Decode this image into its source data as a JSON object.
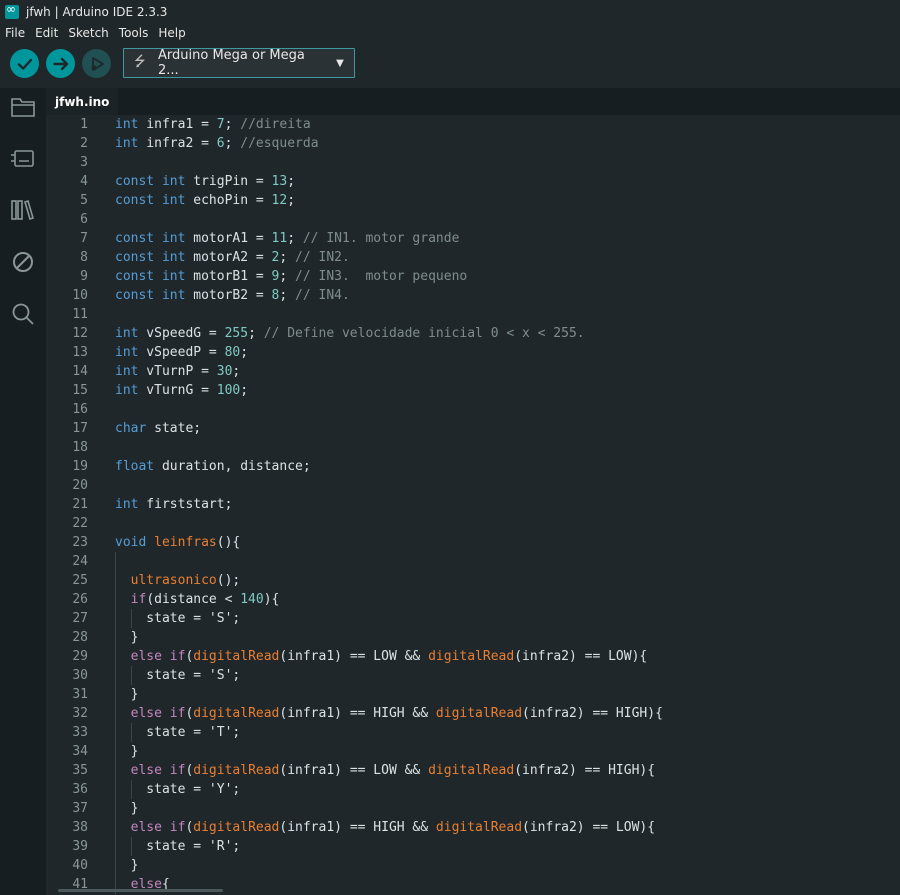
{
  "window": {
    "title": "jfwh | Arduino IDE 2.3.3"
  },
  "menu": [
    "File",
    "Edit",
    "Sketch",
    "Tools",
    "Help"
  ],
  "toolbar": {
    "verify_icon": "check-icon",
    "upload_icon": "arrow-right-icon",
    "debug_icon": "debug-icon",
    "board_label": "Arduino Mega or Mega 2...",
    "usb_icon": "usb-icon",
    "dropdown_icon": "chevron-down-icon",
    "accent": "#00979c"
  },
  "sidebar": [
    "folder-icon",
    "board-icon",
    "library-icon",
    "debug-disabled-icon",
    "search-icon"
  ],
  "tabs": [
    {
      "label": "jfwh.ino"
    }
  ],
  "editor": {
    "lines": [
      [
        [
          "ty",
          "int"
        ],
        [
          "",
          " infra1 = "
        ],
        [
          "num",
          "7"
        ],
        [
          "",
          "; "
        ],
        [
          "cm",
          "//direita"
        ]
      ],
      [
        [
          "ty",
          "int"
        ],
        [
          "",
          " infra2 = "
        ],
        [
          "num",
          "6"
        ],
        [
          "",
          "; "
        ],
        [
          "cm",
          "//esquerda"
        ]
      ],
      [],
      [
        [
          "ty",
          "const"
        ],
        [
          "",
          " "
        ],
        [
          "ty",
          "int"
        ],
        [
          "",
          " trigPin = "
        ],
        [
          "num",
          "13"
        ],
        [
          "",
          ";"
        ]
      ],
      [
        [
          "ty",
          "const"
        ],
        [
          "",
          " "
        ],
        [
          "ty",
          "int"
        ],
        [
          "",
          " echoPin = "
        ],
        [
          "num",
          "12"
        ],
        [
          "",
          ";"
        ]
      ],
      [],
      [
        [
          "ty",
          "const"
        ],
        [
          "",
          " "
        ],
        [
          "ty",
          "int"
        ],
        [
          "",
          " motorA1 = "
        ],
        [
          "num",
          "11"
        ],
        [
          "",
          "; "
        ],
        [
          "cm",
          "// IN1. motor grande"
        ]
      ],
      [
        [
          "ty",
          "const"
        ],
        [
          "",
          " "
        ],
        [
          "ty",
          "int"
        ],
        [
          "",
          " motorA2 = "
        ],
        [
          "num",
          "2"
        ],
        [
          "",
          "; "
        ],
        [
          "cm",
          "// IN2."
        ]
      ],
      [
        [
          "ty",
          "const"
        ],
        [
          "",
          " "
        ],
        [
          "ty",
          "int"
        ],
        [
          "",
          " motorB1 = "
        ],
        [
          "num",
          "9"
        ],
        [
          "",
          "; "
        ],
        [
          "cm",
          "// IN3.  motor pequeno"
        ]
      ],
      [
        [
          "ty",
          "const"
        ],
        [
          "",
          " "
        ],
        [
          "ty",
          "int"
        ],
        [
          "",
          " motorB2 = "
        ],
        [
          "num",
          "8"
        ],
        [
          "",
          "; "
        ],
        [
          "cm",
          "// IN4."
        ]
      ],
      [],
      [
        [
          "ty",
          "int"
        ],
        [
          "",
          " vSpeedG = "
        ],
        [
          "num",
          "255"
        ],
        [
          "",
          "; "
        ],
        [
          "cm",
          "// Define velocidade inicial 0 < x < 255."
        ]
      ],
      [
        [
          "ty",
          "int"
        ],
        [
          "",
          " vSpeedP = "
        ],
        [
          "num",
          "80"
        ],
        [
          "",
          ";"
        ]
      ],
      [
        [
          "ty",
          "int"
        ],
        [
          "",
          " vTurnP = "
        ],
        [
          "num",
          "30"
        ],
        [
          "",
          ";"
        ]
      ],
      [
        [
          "ty",
          "int"
        ],
        [
          "",
          " vTurnG = "
        ],
        [
          "num",
          "100"
        ],
        [
          "",
          ";"
        ]
      ],
      [],
      [
        [
          "ty",
          "char"
        ],
        [
          "",
          " state;"
        ]
      ],
      [],
      [
        [
          "ty",
          "float"
        ],
        [
          "",
          " duration, distance;"
        ]
      ],
      [],
      [
        [
          "ty",
          "int"
        ],
        [
          "",
          " firststart;"
        ]
      ],
      [],
      [
        [
          "ty",
          "void"
        ],
        [
          "",
          " "
        ],
        [
          "fn",
          "leinfras"
        ],
        [
          "",
          "(){"
        ]
      ],
      [],
      [
        [
          "",
          "  "
        ],
        [
          "fn",
          "ultrasonico"
        ],
        [
          "",
          "();"
        ]
      ],
      [
        [
          "",
          "  "
        ],
        [
          "kw",
          "if"
        ],
        [
          "",
          "(distance < "
        ],
        [
          "num",
          "140"
        ],
        [
          "",
          "){"
        ]
      ],
      [
        [
          "",
          "    state = 'S';"
        ]
      ],
      [
        [
          "",
          "  }"
        ]
      ],
      [
        [
          "",
          "  "
        ],
        [
          "kw",
          "else"
        ],
        [
          "",
          " "
        ],
        [
          "kw",
          "if"
        ],
        [
          "",
          "("
        ],
        [
          "fn",
          "digitalRead"
        ],
        [
          "",
          "(infra1) == LOW && "
        ],
        [
          "fn",
          "digitalRead"
        ],
        [
          "",
          "(infra2) == LOW){"
        ]
      ],
      [
        [
          "",
          "    state = 'S';"
        ]
      ],
      [
        [
          "",
          "  }"
        ]
      ],
      [
        [
          "",
          "  "
        ],
        [
          "kw",
          "else"
        ],
        [
          "",
          " "
        ],
        [
          "kw",
          "if"
        ],
        [
          "",
          "("
        ],
        [
          "fn",
          "digitalRead"
        ],
        [
          "",
          "(infra1) == HIGH && "
        ],
        [
          "fn",
          "digitalRead"
        ],
        [
          "",
          "(infra2) == HIGH){"
        ]
      ],
      [
        [
          "",
          "    state = 'T';"
        ]
      ],
      [
        [
          "",
          "  }"
        ]
      ],
      [
        [
          "",
          "  "
        ],
        [
          "kw",
          "else"
        ],
        [
          "",
          " "
        ],
        [
          "kw",
          "if"
        ],
        [
          "",
          "("
        ],
        [
          "fn",
          "digitalRead"
        ],
        [
          "",
          "(infra1) == LOW && "
        ],
        [
          "fn",
          "digitalRead"
        ],
        [
          "",
          "(infra2) == HIGH){"
        ]
      ],
      [
        [
          "",
          "    state = 'Y';"
        ]
      ],
      [
        [
          "",
          "  }"
        ]
      ],
      [
        [
          "",
          "  "
        ],
        [
          "kw",
          "else"
        ],
        [
          "",
          " "
        ],
        [
          "kw",
          "if"
        ],
        [
          "",
          "("
        ],
        [
          "fn",
          "digitalRead"
        ],
        [
          "",
          "(infra1) == HIGH && "
        ],
        [
          "fn",
          "digitalRead"
        ],
        [
          "",
          "(infra2) == LOW){"
        ]
      ],
      [
        [
          "",
          "    state = 'R';"
        ]
      ],
      [
        [
          "",
          "  }"
        ]
      ],
      [
        [
          "",
          "  "
        ],
        [
          "kw",
          "else"
        ],
        [
          "",
          "{"
        ]
      ]
    ]
  }
}
